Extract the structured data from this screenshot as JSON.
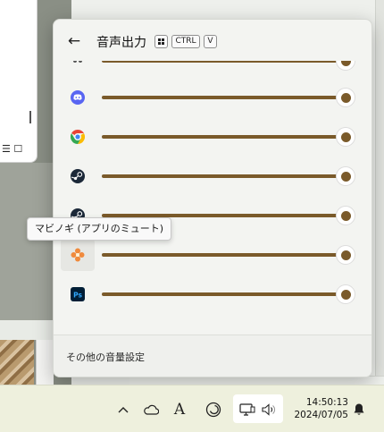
{
  "flyout": {
    "title": "音声出力",
    "shortcut": {
      "key_ctrl": "CTRL",
      "key_v": "V"
    },
    "apps": [
      {
        "name": "Discord",
        "icon": "discord-icon",
        "volume": 1.0
      },
      {
        "name": "Google Chrome",
        "icon": "chrome-icon",
        "volume": 1.0
      },
      {
        "name": "Steam",
        "icon": "steam-icon",
        "volume": 1.0
      },
      {
        "name": "Steam",
        "icon": "steam-icon",
        "volume": 1.0
      },
      {
        "name": "マビノギ",
        "icon": "mabinogi-icon",
        "volume": 1.0
      },
      {
        "name": "Photoshop",
        "icon": "photoshop-icon",
        "volume": 1.0
      }
    ],
    "ps_label": "Ps",
    "more_settings": "その他の音量設定"
  },
  "tooltip": {
    "text": "マビノギ (アプリのミュート)"
  },
  "taskbar": {
    "time": "14:50:13",
    "date": "2024/07/05",
    "ime_label": "A"
  },
  "colors": {
    "accent": "#7a5a2a",
    "discord": "#5865f2",
    "photoshop_bg": "#001e36",
    "photoshop_text": "#31a8ff",
    "mabinogi": "#f08a3c"
  }
}
